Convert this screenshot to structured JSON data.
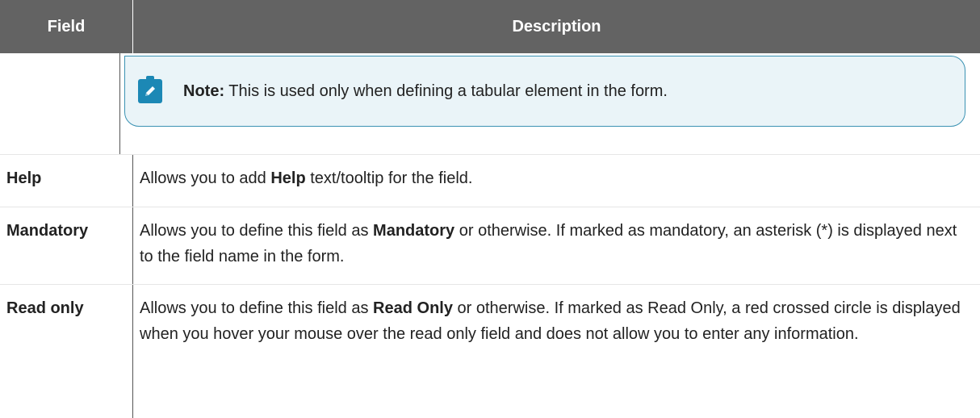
{
  "table": {
    "headers": {
      "field": "Field",
      "description": "Description"
    },
    "note": {
      "label": "Note:",
      "text": " This is used only when defining a tabular element in the form."
    },
    "rows": [
      {
        "field": "Help",
        "desc_parts": [
          "Allows you to add ",
          "Help",
          " text/tooltip for the field."
        ]
      },
      {
        "field": "Mandatory",
        "desc_parts": [
          "Allows you to define this field as ",
          "Mandatory",
          " or otherwise. If marked as mandatory, an asterisk (*) is displayed next to the field name in the form."
        ]
      },
      {
        "field": "Read only",
        "desc_parts": [
          "Allows you to define this field as ",
          "Read Only",
          " or otherwise. If marked as Read Only, a red crossed circle is displayed when you hover your mouse over the read only field and does not allow you to enter any information."
        ]
      }
    ]
  },
  "icons": {
    "note": "pencil-note-icon"
  },
  "colors": {
    "header_bg": "#636363",
    "note_border": "#3b92b3",
    "note_bg": "#eaf4f8",
    "note_icon_bg": "#1c88b5"
  }
}
